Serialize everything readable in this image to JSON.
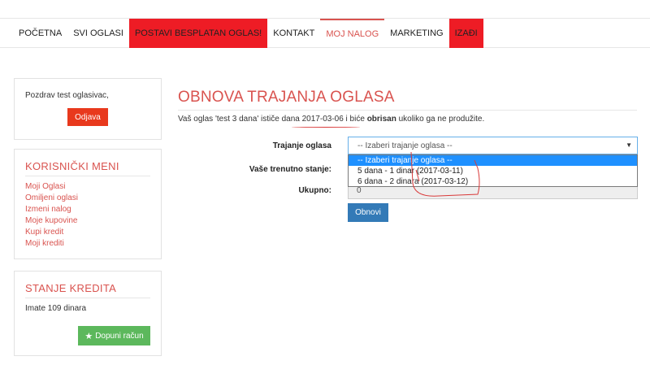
{
  "nav": {
    "items": [
      {
        "label": "POČETNA",
        "style": "normal"
      },
      {
        "label": "SVI OGLASI",
        "style": "normal"
      },
      {
        "label": "POSTAVI BESPLATAN OGLAS!",
        "style": "red"
      },
      {
        "label": "KONTAKT",
        "style": "normal"
      },
      {
        "label": "MOJ NALOG",
        "style": "active"
      },
      {
        "label": "MARKETING",
        "style": "normal"
      },
      {
        "label": "IZAĐI",
        "style": "red"
      }
    ]
  },
  "sidebar": {
    "greeting": "Pozdrav test oglasivac,",
    "logout_label": "Odjava",
    "menu_title": "KORISNIČKI MENI",
    "menu_items": [
      "Moji Oglasi",
      "Omiljeni oglasi",
      "Izmeni nalog",
      "Moje kupovine",
      "Kupi kredit",
      "Moji krediti"
    ],
    "credit_title": "STANJE KREDITA",
    "credit_text": "Imate 109 dinara",
    "topup_label": "Dopuni račun"
  },
  "main": {
    "title": "OBNOVA TRAJANJA OGLASA",
    "info_pre": "Vaš oglas 'test 3 dana' ističe dana ",
    "info_date": "2017-03-06",
    "info_mid": " i biće ",
    "info_bold": "obrisan",
    "info_post": " ukoliko ga ne produžite.",
    "duration_label": "Trajanje oglasa",
    "status_label": "Vaše trenutno stanje:",
    "total_label": "Ukupno:",
    "total_value": "0",
    "select_value": "-- Izaberi trajanje oglasa --",
    "options": [
      "-- Izaberi trajanje oglasa --",
      "5 dana - 1 dinar (2017-03-11)",
      "6 dana - 2 dinara (2017-03-12)"
    ],
    "renew_label": "Obnovi"
  },
  "colors": {
    "accent_red": "#d9534f",
    "nav_red": "#ee1c25",
    "logout_red": "#e8391d",
    "green": "#5cb85c",
    "blue": "#337ab7",
    "highlight": "#1e90ff"
  }
}
